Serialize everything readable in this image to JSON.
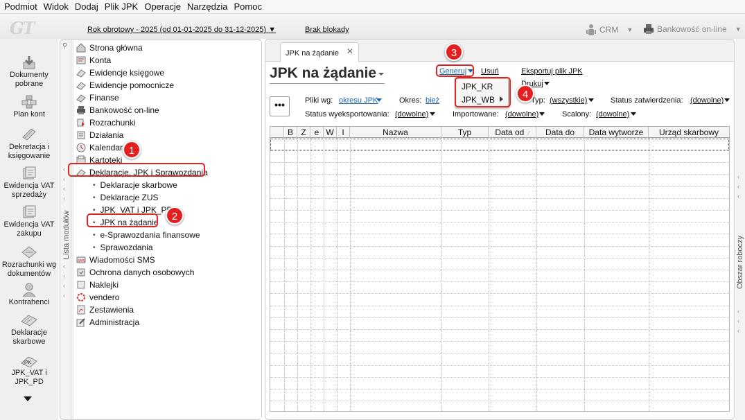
{
  "menubar": [
    "Podmiot",
    "Widok",
    "Dodaj",
    "Plik JPK",
    "Operacje",
    "Narzędzia",
    "Pomoc"
  ],
  "toolbar": {
    "logo": "GT",
    "year_selector": "Rok obrotowy - 2025  (od 01-01-2025 do 31-12-2025)",
    "lock_status": "Brak blokady",
    "crm": "CRM",
    "bank": "Bankowość on-line"
  },
  "leftbar": [
    {
      "label": "Dokumenty pobrane",
      "icon": "download-icon"
    },
    {
      "label": "Plan kont",
      "icon": "chart-of-accounts-icon"
    },
    {
      "label": "Dekretacja i księgowanie",
      "icon": "posting-icon"
    },
    {
      "label": "Ewidencja VAT sprzedaży",
      "icon": "vat-sales-icon"
    },
    {
      "label": "Ewidencja VAT zakupu",
      "icon": "vat-purchase-icon"
    },
    {
      "label": "Rozrachunki wg dokumentów",
      "icon": "settlements-icon"
    },
    {
      "label": "Kontrahenci",
      "icon": "contractors-icon"
    },
    {
      "label": "Deklaracje skarbowe",
      "icon": "tax-declarations-icon"
    },
    {
      "label": "JPK_VAT i JPK_PD",
      "icon": "jpk-icon"
    }
  ],
  "modules_panel": {
    "vertical_label": "Lista modułów",
    "items": [
      {
        "label": "Strona główna"
      },
      {
        "label": "Konta"
      },
      {
        "label": "Ewidencje księgowe"
      },
      {
        "label": "Ewidencje pomocnicze"
      },
      {
        "label": "Finanse"
      },
      {
        "label": "Bankowość on-line"
      },
      {
        "label": "Rozrachunki"
      },
      {
        "label": "Działania"
      },
      {
        "label": "Kalendarz"
      },
      {
        "label": "Kartoteki"
      },
      {
        "label": "Deklaracje, JPK i Sprawozdania"
      },
      {
        "label": "Wiadomości SMS"
      },
      {
        "label": "Ochrona danych osobowych"
      },
      {
        "label": "Naklejki"
      },
      {
        "label": "vendero"
      },
      {
        "label": "Zestawienia"
      },
      {
        "label": "Administracja"
      }
    ],
    "subitems": [
      {
        "label": "Deklaracje skarbowe"
      },
      {
        "label": "Deklaracje ZUS"
      },
      {
        "label": "JPK_VAT i JPK_PD"
      },
      {
        "label": "JPK na żądanie"
      },
      {
        "label": "e-Sprawozdania finansowe"
      },
      {
        "label": "Sprawozdania"
      }
    ]
  },
  "main": {
    "tab_label": "JPK na żądanie",
    "title": "JPK na żądanie",
    "actions": {
      "generate": "Generuj",
      "delete": "Usuń",
      "export": "Eksportuj plik JPK",
      "print": "Drukuj"
    },
    "generate_menu": [
      "JPK_KR",
      "JPK_WB"
    ],
    "filters": {
      "files_by_label": "Pliki wg:",
      "files_by_value": "okresu JPK",
      "period_label": "Okres:",
      "period_value": "bież",
      "type_label": "Typ:",
      "type_value": "(wszystkie)",
      "approval_label": "Status zatwierdzenia:",
      "approval_value": "(dowolne)",
      "export_status_label": "Status wyeksportowania:",
      "export_status_value": "(dowolne)",
      "imported_label": "Importowane:",
      "imported_value": "(dowolne)",
      "merged_label": "Scalony:",
      "merged_value": "(dowolne)"
    },
    "table": {
      "columns": [
        "",
        "B",
        "Z",
        "e",
        "W",
        "I",
        "Nazwa",
        "Typ",
        "Data od",
        "Data do",
        "Data wytworze",
        "Urząd skarbowy"
      ],
      "rows": []
    }
  },
  "right_panel_label": "Obszar roboczy",
  "annotations": [
    "1",
    "2",
    "3",
    "4"
  ],
  "colors": {
    "highlight": "#e02424",
    "link_blue": "#1e62b0"
  }
}
